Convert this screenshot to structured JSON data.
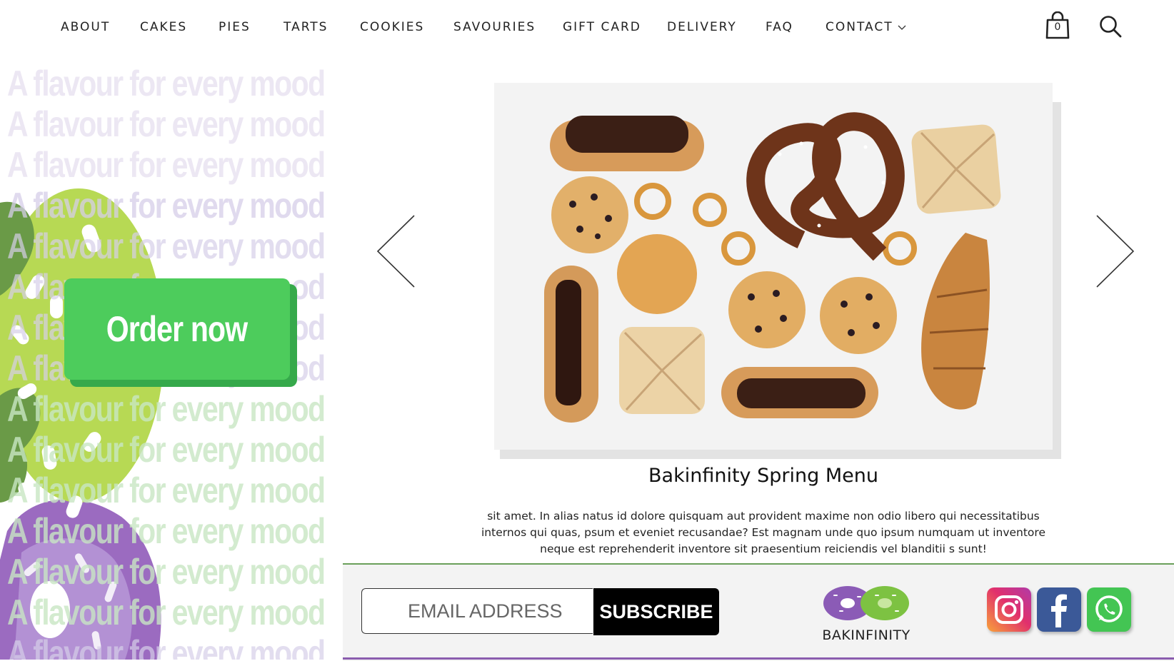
{
  "colors": {
    "order_green": "#4dcc5c",
    "blob_lime": "#b7d954",
    "blob_purple": "#9b6bc0",
    "text_faded_purple": "#ece7f3",
    "text_faded_green": "#e4f3df",
    "footer_bg": "#f3f3f3"
  },
  "nav": {
    "items": [
      "ABOUT",
      "CAKES",
      "PIES",
      "TARTS",
      "COOKIES",
      "SAVOURIES",
      "GIFT CARD",
      "DELIVERY",
      "FAQ",
      "CONTACT"
    ],
    "cart_count": "0",
    "cart_icon": "shopping-bag-icon",
    "search_icon": "search-icon"
  },
  "hero_left": {
    "repeat_text": "A flavour for every mood",
    "order_button": "Order now"
  },
  "carousel": {
    "prev_icon": "chevron-left-icon",
    "next_icon": "chevron-right-icon",
    "image_alt": "pastries",
    "title": "Bakinfinity Spring Menu",
    "description": "sit amet. In alias natus id dolore quisquam aut provident maxime  non odio libero qui necessitatibus internos qui quas, psum et eveniet recusandae?  Est magnam unde quo ipsum numquam ut inventore neque est reprehenderit inventore sit praesentium reiciendis vel blanditii s sunt!"
  },
  "footer": {
    "email_placeholder": "EMAIL ADDRESS",
    "subscribe_label": "SUBSCRIBE",
    "logo_text": "BAKINFINITY",
    "social": [
      "instagram-icon",
      "facebook-icon",
      "whatsapp-icon"
    ]
  }
}
